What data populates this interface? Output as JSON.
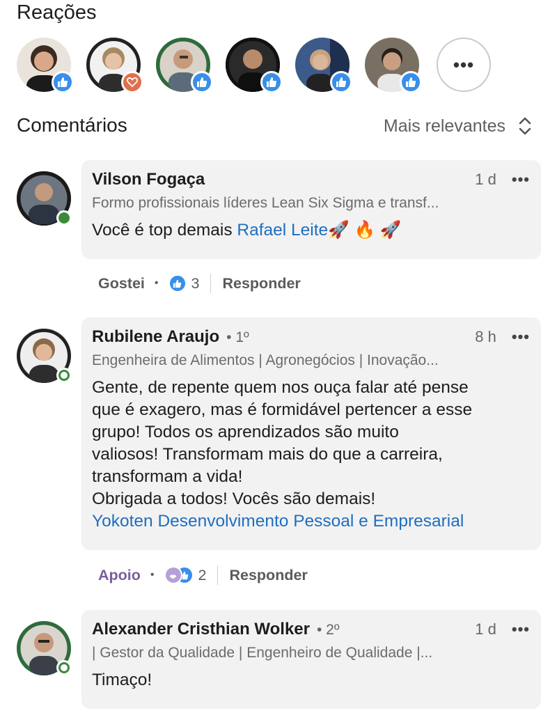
{
  "reactions": {
    "title": "Reações",
    "people": [
      {
        "reaction": "like",
        "photo_colors": [
          "#5a4236",
          "#d9a88a"
        ]
      },
      {
        "reaction": "love",
        "photo_colors": [
          "#c8b7a8",
          "#e6c2a6"
        ]
      },
      {
        "reaction": "like",
        "photo_colors": [
          "#2e6b3c",
          "#c89a7c"
        ]
      },
      {
        "reaction": "like",
        "photo_colors": [
          "#1c1c1c",
          "#b98b6b"
        ]
      },
      {
        "reaction": "like",
        "photo_colors": [
          "#3c5a8a",
          "#d8b79c"
        ]
      },
      {
        "reaction": "like",
        "photo_colors": [
          "#7a6f63",
          "#c99f83"
        ]
      }
    ],
    "more_label": "•••"
  },
  "comments_header": {
    "title": "Comentários",
    "sort_label": "Mais relevantes"
  },
  "comments": [
    {
      "name": "Vilson Fogaça",
      "degree": "",
      "time": "1 d",
      "more": "•••",
      "headline": "Formo profissionais líderes Lean Six Sigma e transf...",
      "body_text": "Você é top demais ",
      "mention": "Rafael Leite",
      "body_suffix": "🚀 🔥 🚀",
      "actions": {
        "reaction_label": "Gostei",
        "dot": "•",
        "count": "3",
        "reply_label": "Responder"
      }
    },
    {
      "name": "Rubilene Araujo",
      "degree": "• 1º",
      "time": "8 h",
      "more": "•••",
      "headline": "Engenheira de Alimentos | Agronegócios | Inovação...",
      "body_lines": [
        "Gente, de repente quem nos ouça falar até pense",
        "que é exagero, mas é formidável pertencer a esse",
        "grupo! Todos os aprendizados são muito",
        "valiosos! Transformam mais do que a carreira,",
        "transformam a vida!",
        "Obrigada a todos! Vocês são demais!"
      ],
      "mention": "Yokoten Desenvolvimento Pessoal e Empresarial",
      "actions": {
        "reaction_label": "Apoio",
        "dot": "•",
        "count": "2",
        "reply_label": "Responder"
      }
    },
    {
      "name": "Alexander Cristhian Wolker",
      "degree": "• 2º",
      "time": "1 d",
      "more": "•••",
      "headline": "| Gestor da Qualidade | Engenheiro de Qualidade |...",
      "body_text": "Timaço!"
    }
  ],
  "colors": {
    "link": "#1f6ec0",
    "like": "#378fe9",
    "love": "#df704d",
    "support": "#b6a1d6",
    "online": "#3a8a3a"
  }
}
